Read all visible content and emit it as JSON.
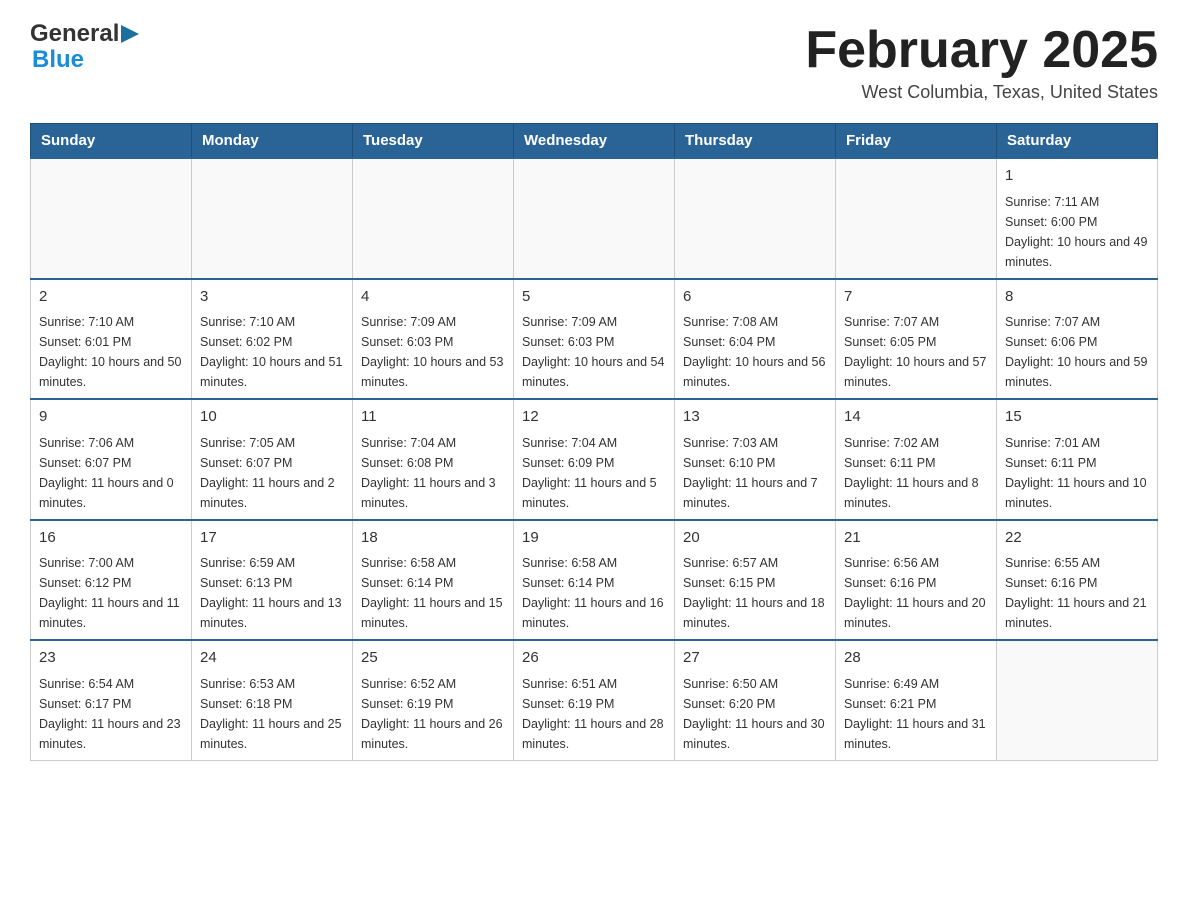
{
  "logo": {
    "general": "General",
    "blue": "Blue"
  },
  "title": "February 2025",
  "location": "West Columbia, Texas, United States",
  "weekdays": [
    "Sunday",
    "Monday",
    "Tuesday",
    "Wednesday",
    "Thursday",
    "Friday",
    "Saturday"
  ],
  "weeks": [
    [
      {
        "day": "",
        "sunrise": "",
        "sunset": "",
        "daylight": ""
      },
      {
        "day": "",
        "sunrise": "",
        "sunset": "",
        "daylight": ""
      },
      {
        "day": "",
        "sunrise": "",
        "sunset": "",
        "daylight": ""
      },
      {
        "day": "",
        "sunrise": "",
        "sunset": "",
        "daylight": ""
      },
      {
        "day": "",
        "sunrise": "",
        "sunset": "",
        "daylight": ""
      },
      {
        "day": "",
        "sunrise": "",
        "sunset": "",
        "daylight": ""
      },
      {
        "day": "1",
        "sunrise": "Sunrise: 7:11 AM",
        "sunset": "Sunset: 6:00 PM",
        "daylight": "Daylight: 10 hours and 49 minutes."
      }
    ],
    [
      {
        "day": "2",
        "sunrise": "Sunrise: 7:10 AM",
        "sunset": "Sunset: 6:01 PM",
        "daylight": "Daylight: 10 hours and 50 minutes."
      },
      {
        "day": "3",
        "sunrise": "Sunrise: 7:10 AM",
        "sunset": "Sunset: 6:02 PM",
        "daylight": "Daylight: 10 hours and 51 minutes."
      },
      {
        "day": "4",
        "sunrise": "Sunrise: 7:09 AM",
        "sunset": "Sunset: 6:03 PM",
        "daylight": "Daylight: 10 hours and 53 minutes."
      },
      {
        "day": "5",
        "sunrise": "Sunrise: 7:09 AM",
        "sunset": "Sunset: 6:03 PM",
        "daylight": "Daylight: 10 hours and 54 minutes."
      },
      {
        "day": "6",
        "sunrise": "Sunrise: 7:08 AM",
        "sunset": "Sunset: 6:04 PM",
        "daylight": "Daylight: 10 hours and 56 minutes."
      },
      {
        "day": "7",
        "sunrise": "Sunrise: 7:07 AM",
        "sunset": "Sunset: 6:05 PM",
        "daylight": "Daylight: 10 hours and 57 minutes."
      },
      {
        "day": "8",
        "sunrise": "Sunrise: 7:07 AM",
        "sunset": "Sunset: 6:06 PM",
        "daylight": "Daylight: 10 hours and 59 minutes."
      }
    ],
    [
      {
        "day": "9",
        "sunrise": "Sunrise: 7:06 AM",
        "sunset": "Sunset: 6:07 PM",
        "daylight": "Daylight: 11 hours and 0 minutes."
      },
      {
        "day": "10",
        "sunrise": "Sunrise: 7:05 AM",
        "sunset": "Sunset: 6:07 PM",
        "daylight": "Daylight: 11 hours and 2 minutes."
      },
      {
        "day": "11",
        "sunrise": "Sunrise: 7:04 AM",
        "sunset": "Sunset: 6:08 PM",
        "daylight": "Daylight: 11 hours and 3 minutes."
      },
      {
        "day": "12",
        "sunrise": "Sunrise: 7:04 AM",
        "sunset": "Sunset: 6:09 PM",
        "daylight": "Daylight: 11 hours and 5 minutes."
      },
      {
        "day": "13",
        "sunrise": "Sunrise: 7:03 AM",
        "sunset": "Sunset: 6:10 PM",
        "daylight": "Daylight: 11 hours and 7 minutes."
      },
      {
        "day": "14",
        "sunrise": "Sunrise: 7:02 AM",
        "sunset": "Sunset: 6:11 PM",
        "daylight": "Daylight: 11 hours and 8 minutes."
      },
      {
        "day": "15",
        "sunrise": "Sunrise: 7:01 AM",
        "sunset": "Sunset: 6:11 PM",
        "daylight": "Daylight: 11 hours and 10 minutes."
      }
    ],
    [
      {
        "day": "16",
        "sunrise": "Sunrise: 7:00 AM",
        "sunset": "Sunset: 6:12 PM",
        "daylight": "Daylight: 11 hours and 11 minutes."
      },
      {
        "day": "17",
        "sunrise": "Sunrise: 6:59 AM",
        "sunset": "Sunset: 6:13 PM",
        "daylight": "Daylight: 11 hours and 13 minutes."
      },
      {
        "day": "18",
        "sunrise": "Sunrise: 6:58 AM",
        "sunset": "Sunset: 6:14 PM",
        "daylight": "Daylight: 11 hours and 15 minutes."
      },
      {
        "day": "19",
        "sunrise": "Sunrise: 6:58 AM",
        "sunset": "Sunset: 6:14 PM",
        "daylight": "Daylight: 11 hours and 16 minutes."
      },
      {
        "day": "20",
        "sunrise": "Sunrise: 6:57 AM",
        "sunset": "Sunset: 6:15 PM",
        "daylight": "Daylight: 11 hours and 18 minutes."
      },
      {
        "day": "21",
        "sunrise": "Sunrise: 6:56 AM",
        "sunset": "Sunset: 6:16 PM",
        "daylight": "Daylight: 11 hours and 20 minutes."
      },
      {
        "day": "22",
        "sunrise": "Sunrise: 6:55 AM",
        "sunset": "Sunset: 6:16 PM",
        "daylight": "Daylight: 11 hours and 21 minutes."
      }
    ],
    [
      {
        "day": "23",
        "sunrise": "Sunrise: 6:54 AM",
        "sunset": "Sunset: 6:17 PM",
        "daylight": "Daylight: 11 hours and 23 minutes."
      },
      {
        "day": "24",
        "sunrise": "Sunrise: 6:53 AM",
        "sunset": "Sunset: 6:18 PM",
        "daylight": "Daylight: 11 hours and 25 minutes."
      },
      {
        "day": "25",
        "sunrise": "Sunrise: 6:52 AM",
        "sunset": "Sunset: 6:19 PM",
        "daylight": "Daylight: 11 hours and 26 minutes."
      },
      {
        "day": "26",
        "sunrise": "Sunrise: 6:51 AM",
        "sunset": "Sunset: 6:19 PM",
        "daylight": "Daylight: 11 hours and 28 minutes."
      },
      {
        "day": "27",
        "sunrise": "Sunrise: 6:50 AM",
        "sunset": "Sunset: 6:20 PM",
        "daylight": "Daylight: 11 hours and 30 minutes."
      },
      {
        "day": "28",
        "sunrise": "Sunrise: 6:49 AM",
        "sunset": "Sunset: 6:21 PM",
        "daylight": "Daylight: 11 hours and 31 minutes."
      },
      {
        "day": "",
        "sunrise": "",
        "sunset": "",
        "daylight": ""
      }
    ]
  ]
}
